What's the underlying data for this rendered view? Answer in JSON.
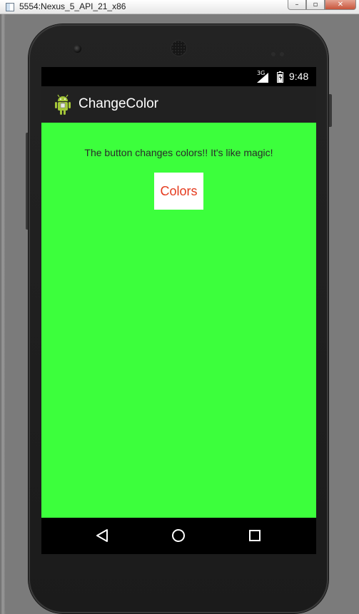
{
  "window": {
    "title": "5554:Nexus_5_API_21_x86",
    "controls": {
      "minimize_icon": "minimize-icon",
      "maximize_icon": "maximize-icon",
      "close_icon": "close-icon"
    }
  },
  "device": {
    "status_bar": {
      "network_type": "3G",
      "time": "9:48",
      "icons": [
        "signal-icon",
        "battery-icon"
      ]
    },
    "action_bar": {
      "app_icon": "android-logo-icon",
      "title": "ChangeColor"
    },
    "content": {
      "background_color": "#3cff3c",
      "message": "The button changes colors!! It's like magic!",
      "button_label": "Colors",
      "button_text_color": "#e53a1e",
      "button_background_color": "#ffffff"
    },
    "nav_bar": {
      "items": [
        "back-icon",
        "home-icon",
        "recents-icon"
      ]
    }
  },
  "colors": {
    "brand_green": "#a4c639",
    "action_bar": "#212121",
    "status_bar": "#000000"
  }
}
